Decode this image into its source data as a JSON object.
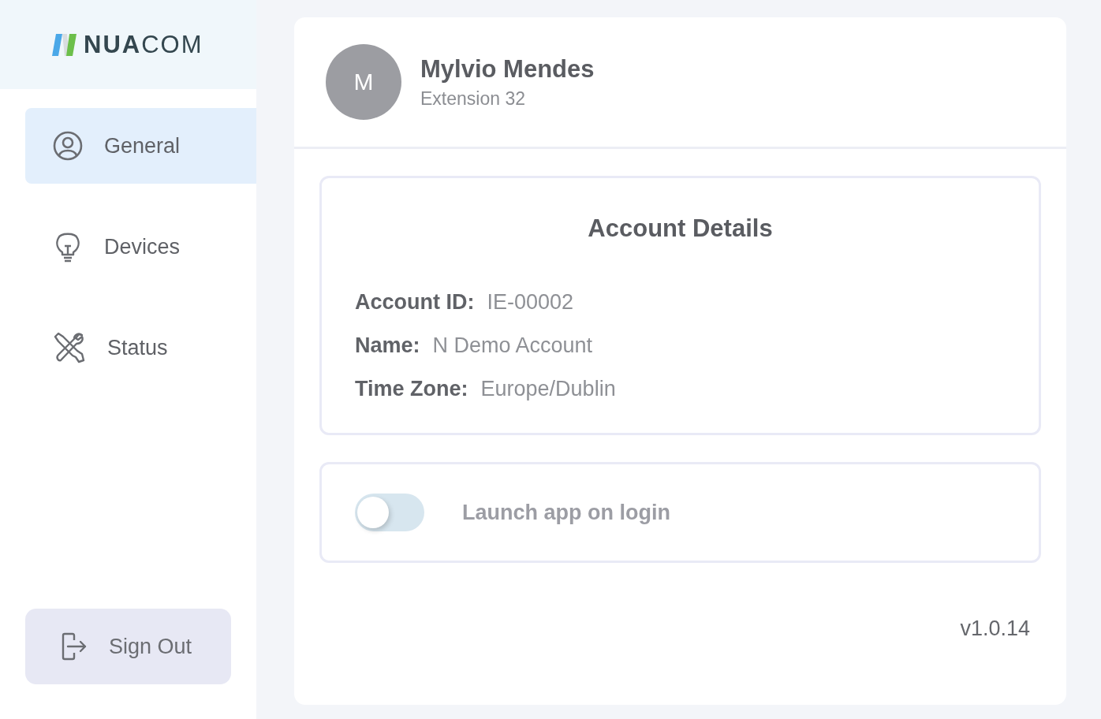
{
  "logo": {
    "text": "**NUA**COM"
  },
  "nav": [
    {
      "label": "General",
      "kind": "user",
      "selected": true
    },
    {
      "label": "Devices",
      "kind": "bulb",
      "selected": false
    },
    {
      "label": "Status",
      "kind": "tools",
      "selected": false
    }
  ],
  "sign_out": {
    "label": "Sign Out"
  },
  "profile": {
    "initial": "M",
    "name": "Mylvio Mendes",
    "extension": "Extension 32"
  },
  "account": {
    "title": "Account Details",
    "fields": [
      {
        "label": "Account ID:",
        "value": "IE-00002"
      },
      {
        "label": "Name:",
        "value": "N Demo Account"
      },
      {
        "label": "Time Zone:",
        "value": "Europe/Dublin"
      }
    ]
  },
  "launch": {
    "label": "Launch app on login",
    "on": false
  },
  "version": "v1.0.14"
}
